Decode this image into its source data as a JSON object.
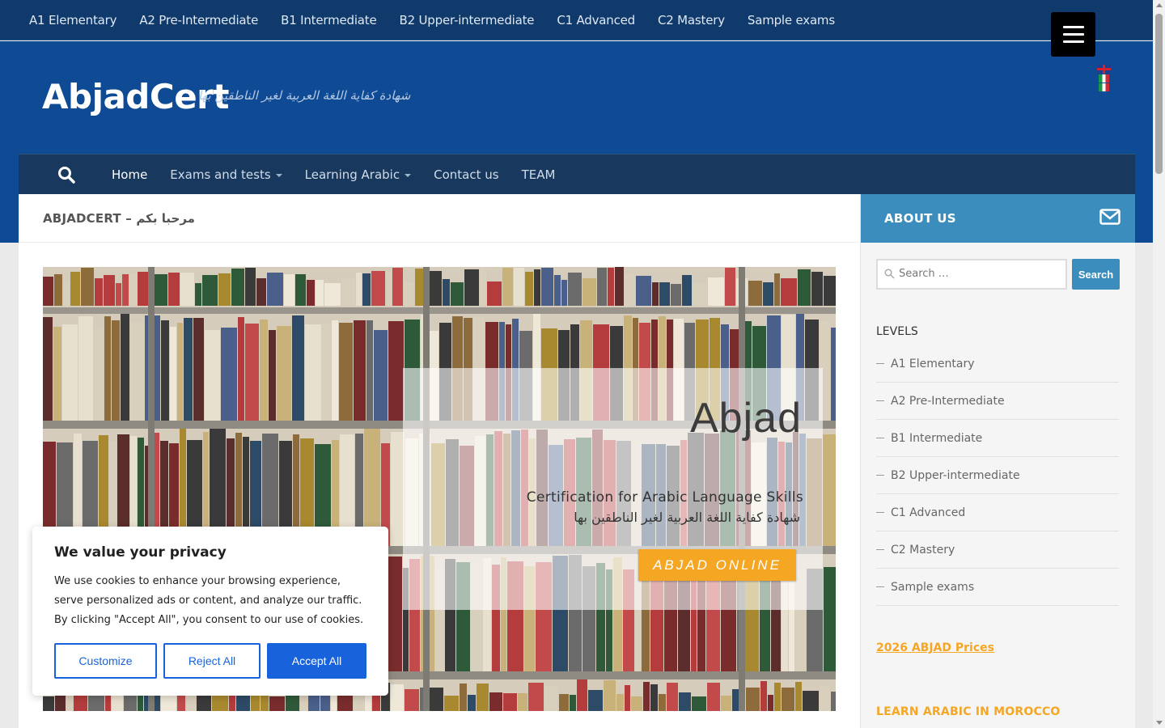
{
  "topnav": [
    "A1 Elementary",
    "A2 Pre-Intermediate",
    "B1 Intermediate",
    "B2 Upper-intermediate",
    "C1 Advanced",
    "C2 Mastery",
    "Sample exams"
  ],
  "site": {
    "title": "AbjadCert",
    "tagline": "شهادة كفاية اللغة العربية لغير الناطقين بها"
  },
  "mainnav": {
    "home": "Home",
    "exams": "Exams and tests",
    "learning": "Learning Arabic",
    "contact": "Contact us",
    "team": "TEAM"
  },
  "page": {
    "heading": "ABJADCERT – مرحبا بكم"
  },
  "hero": {
    "title": "Abjad",
    "subtitle_en": "Certification for Arabic Language Skills",
    "subtitle_ar": "شهادة كفاية اللغة العربية لغير الناطقين بها",
    "button": "ABJAD  ONLINE"
  },
  "sidebar": {
    "about": "ABOUT US",
    "search_placeholder": "Search …",
    "search_button": "Search",
    "levels_title": "LEVELS",
    "levels": [
      "A1 Elementary",
      "A2 Pre-Intermediate",
      "B1 Intermediate",
      "B2 Upper-intermediate",
      "C1 Advanced",
      "C2 Mastery",
      "Sample exams"
    ],
    "prices_link": "2026 ABJAD Prices",
    "learn_title": "LEARN ARABIC IN MOROCCO"
  },
  "cookie": {
    "title": "We value your privacy",
    "text": "We use cookies to enhance your browsing experience, serve personalized ads or content, and analyze our traffic. By clicking \"Accept All\", you consent to our use of cookies.",
    "customize": "Customize",
    "reject": "Reject All",
    "accept": "Accept All"
  },
  "colors": {
    "topbar": "#0f3a6b",
    "header": "#0f4a95",
    "mainnav": "#18385e",
    "accent_blue": "#3b8dbd",
    "accent_orange": "#f5a623",
    "cookie_blue": "#1863dc"
  }
}
